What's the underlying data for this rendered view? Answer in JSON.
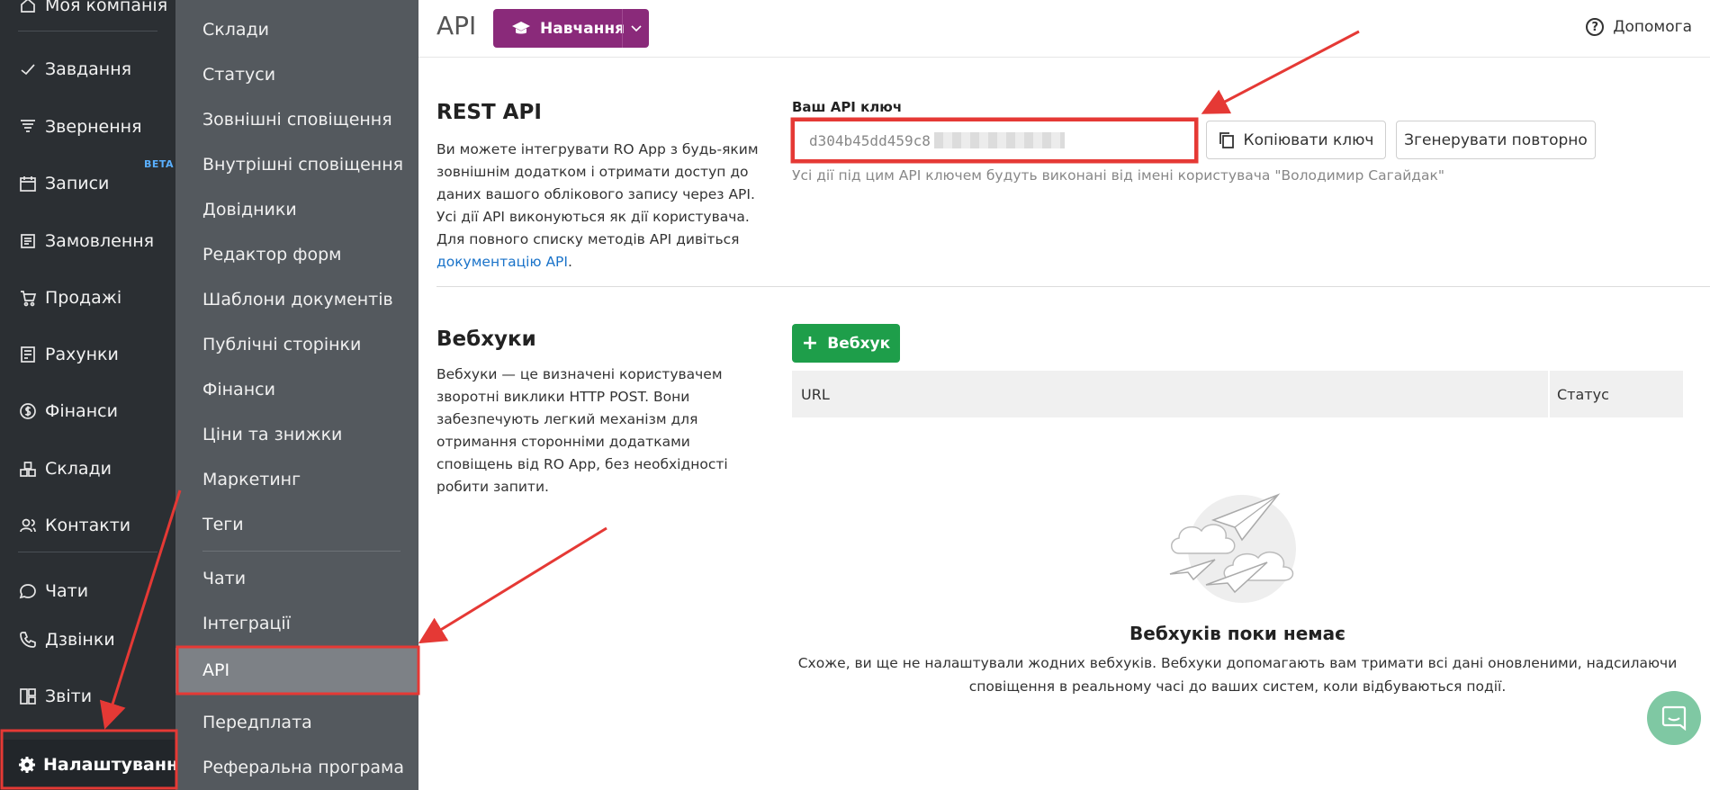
{
  "sidebar": {
    "items": [
      {
        "label": "Моя компанія",
        "icon": "home-icon"
      },
      {
        "label": "Завдання",
        "icon": "check-icon"
      },
      {
        "label": "Звернення",
        "icon": "funnel-icon"
      },
      {
        "label": "Записи",
        "icon": "calendar-icon"
      },
      {
        "label": "Замовлення",
        "icon": "order-icon"
      },
      {
        "label": "Продажі",
        "icon": "cart-icon"
      },
      {
        "label": "Рахунки",
        "icon": "invoice-icon"
      },
      {
        "label": "Фінанси",
        "icon": "dollar-icon"
      },
      {
        "label": "Склади",
        "icon": "boxes-icon"
      },
      {
        "label": "Контакти",
        "icon": "contacts-icon"
      },
      {
        "label": "Чати",
        "icon": "chat-icon"
      },
      {
        "label": "Дзвінки",
        "icon": "phone-icon"
      },
      {
        "label": "Звіти",
        "icon": "reports-icon"
      },
      {
        "label": "Налаштування",
        "icon": "gear-icon"
      }
    ],
    "beta_badge": "BETA"
  },
  "subnav": {
    "items": [
      "Склади",
      "Статуси",
      "Зовнішні сповіщення",
      "Внутрішні сповіщення",
      "Довідники",
      "Редактор форм",
      "Шаблони документів",
      "Публічні сторінки",
      "Фінанси",
      "Ціни та знижки",
      "Маркетинг",
      "Теги",
      "Чати",
      "Інтеграції",
      "API",
      "Передплата",
      "Реферальна програма"
    ]
  },
  "header": {
    "title": "API",
    "learn_button": "Навчання",
    "help": "Допомога"
  },
  "rest_api": {
    "title": "REST API",
    "desc_text": "Ви можете інтегрувати RO App з будь-яким зовнішнім додатком і отримати доступ до даних вашого облікового запису через API. Усі дії API виконуються як дії користувача. Для повного списку методів API дивіться ",
    "desc_link": "документацію API",
    "desc_end": ".",
    "key_label": "Ваш API ключ",
    "key_value": "d304b45dd459c8",
    "copy_button": "Копіювати ключ",
    "regen_button": "Згенерувати повторно",
    "key_hint": "Усі дії під цим API ключем будуть виконані від імені користувача \"Володимир Сагайдак\""
  },
  "webhooks": {
    "title": "Вебхуки",
    "desc": "Вебхуки — це визначені користувачем зворотні виклики HTTP POST. Вони забезпечують легкий механізм для отримання сторонніми додатками сповіщень від RO App, без необхідності робити запити.",
    "add_button": "Вебхук",
    "columns": [
      "URL",
      "Статус"
    ],
    "empty_title": "Вебхуків поки немає",
    "empty_desc": "Схоже, ви ще не налаштували жодних вебхуків. Вебхуки допомагають вам тримати всі дані оновленими, надсилаючи сповіщення в реальному часі до ваших систем, коли відбуваються події."
  },
  "colors": {
    "sidebar_bg": "#2b2f33",
    "subnav_bg": "#54595e",
    "accent_purple": "#8a2a7a",
    "accent_green": "#1e9e4a",
    "annotation_red": "#e53935"
  }
}
